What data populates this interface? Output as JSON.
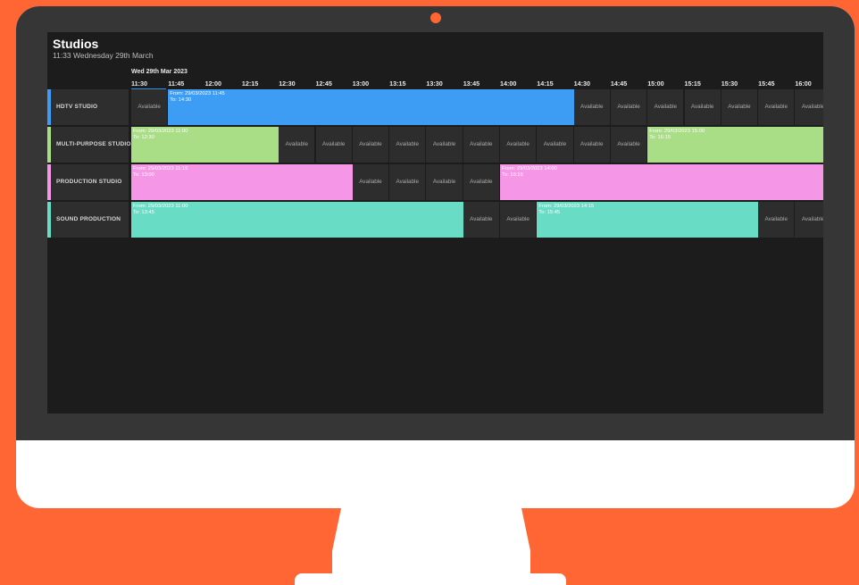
{
  "app": {
    "title": "Studios",
    "subtitle": "11:33 Wednesday 29th March",
    "date_label": "Wed 29th Mar 2023"
  },
  "timeline": {
    "times": [
      "11:30",
      "11:45",
      "12:00",
      "12:15",
      "12:30",
      "12:45",
      "13:00",
      "13:15",
      "13:30",
      "13:45",
      "14:00",
      "14:15",
      "14:30",
      "14:45",
      "15:00",
      "15:15",
      "15:30",
      "15:45",
      "16:00"
    ],
    "current_index": 0,
    "available_label": "Available"
  },
  "studios": [
    {
      "name": "HDTV STUDIO",
      "color": "#3d9df5",
      "bookings": [
        {
          "from": "From: 29/03/2023 11:45",
          "to": "To: 14:30",
          "start_index": 1,
          "end_index": 12
        }
      ]
    },
    {
      "name": "MULTI-PURPOSE STUDIO",
      "color": "#a9dd86",
      "bookings": [
        {
          "from": "From: 29/03/2023 11:00",
          "to": "To: 12:30",
          "start_index": 0,
          "end_index": 4
        },
        {
          "from": "From: 29/03/2023 15:00",
          "to": "To: 16:15",
          "start_index": 14,
          "end_index": 19
        }
      ]
    },
    {
      "name": "PRODUCTION STUDIO",
      "color": "#f597e6",
      "bookings": [
        {
          "from": "From: 29/03/2023 11:15",
          "to": "To: 13:00",
          "start_index": 0,
          "end_index": 6
        },
        {
          "from": "From: 29/03/2023 14:00",
          "to": "To: 16:15",
          "start_index": 10,
          "end_index": 19
        }
      ]
    },
    {
      "name": "SOUND PRODUCTION",
      "color": "#69dcc6",
      "bookings": [
        {
          "from": "From: 29/03/2023 11:00",
          "to": "To: 13:45",
          "start_index": 0,
          "end_index": 9
        },
        {
          "from": "From: 29/03/2023 14:15",
          "to": "To: 15:45",
          "start_index": 11,
          "end_index": 17
        }
      ]
    }
  ]
}
